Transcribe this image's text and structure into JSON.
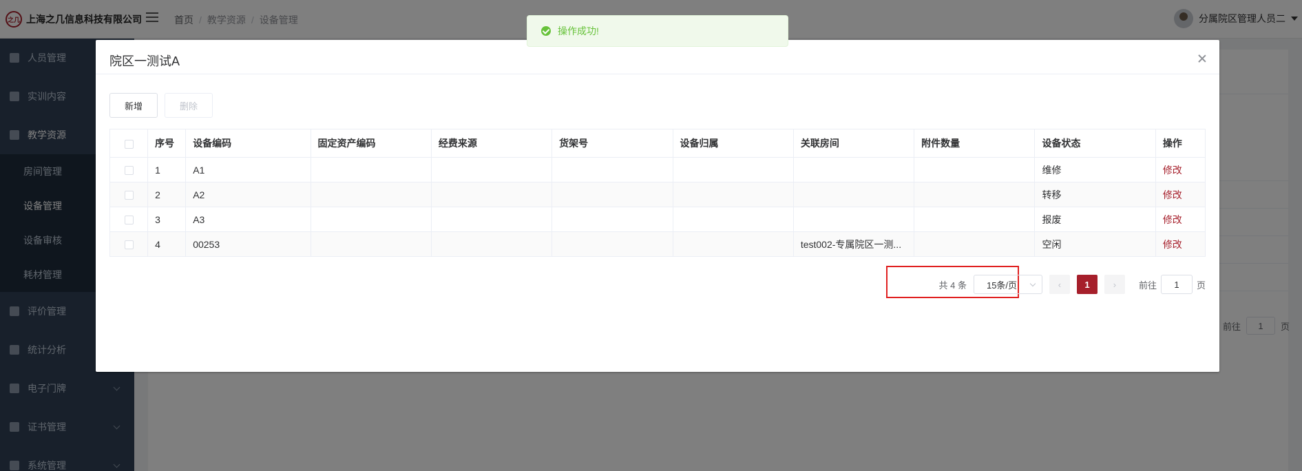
{
  "header": {
    "logo_mark": "之几",
    "company": "上海之几信息科技有限公司",
    "breadcrumb": [
      "首页",
      "教学资源",
      "设备管理"
    ],
    "user_name": "分属院区管理人员二"
  },
  "sidebar": {
    "items": [
      {
        "label": "人员管理",
        "icon": "user-icon"
      },
      {
        "label": "实训内容",
        "icon": "document-icon"
      },
      {
        "label": "教学资源",
        "icon": "book-icon"
      },
      {
        "label": "评价管理",
        "icon": "image-icon"
      },
      {
        "label": "统计分析",
        "icon": "bar-chart-icon"
      },
      {
        "label": "电子门牌",
        "icon": "monitor-icon"
      },
      {
        "label": "证书管理",
        "icon": "briefcase-icon"
      },
      {
        "label": "系统管理",
        "icon": "gear-icon"
      }
    ],
    "submenu": [
      {
        "label": "房间管理"
      },
      {
        "label": "设备管理"
      },
      {
        "label": "设备审核"
      },
      {
        "label": "耗材管理"
      }
    ]
  },
  "background": {
    "pager_goto": "前往",
    "pager_page": "1",
    "pager_suffix": "页"
  },
  "toast": {
    "message": "操作成功!",
    "color": "#67c23a"
  },
  "dialog": {
    "title": "院区一测试A",
    "add_label": "新增",
    "delete_label": "删除",
    "columns": [
      "序号",
      "设备编码",
      "固定资产编码",
      "经费来源",
      "货架号",
      "设备归属",
      "关联房间",
      "附件数量",
      "设备状态",
      "操作"
    ],
    "rows": [
      {
        "index": "1",
        "code": "A1",
        "asset": "",
        "fund": "",
        "shelf": "",
        "owner": "",
        "room": "",
        "attachments": "",
        "status": "维修",
        "action": "修改"
      },
      {
        "index": "2",
        "code": "A2",
        "asset": "",
        "fund": "",
        "shelf": "",
        "owner": "",
        "room": "",
        "attachments": "",
        "status": "转移",
        "action": "修改"
      },
      {
        "index": "3",
        "code": "A3",
        "asset": "",
        "fund": "",
        "shelf": "",
        "owner": "",
        "room": "",
        "attachments": "",
        "status": "报废",
        "action": "修改"
      },
      {
        "index": "4",
        "code": "00253",
        "asset": "",
        "fund": "",
        "shelf": "",
        "owner": "",
        "room": "test002-专属院区一测...",
        "attachments": "",
        "status": "空闲",
        "action": "修改"
      }
    ],
    "pager": {
      "total": "共 4 条",
      "page_size": "15条/页",
      "current_page": "1",
      "goto_label": "前往",
      "goto_value": "1",
      "page_suffix": "页"
    }
  },
  "colors": {
    "accent": "#a61f2b",
    "sidebar_bg": "#304156",
    "highlight_border": "#e02020"
  }
}
